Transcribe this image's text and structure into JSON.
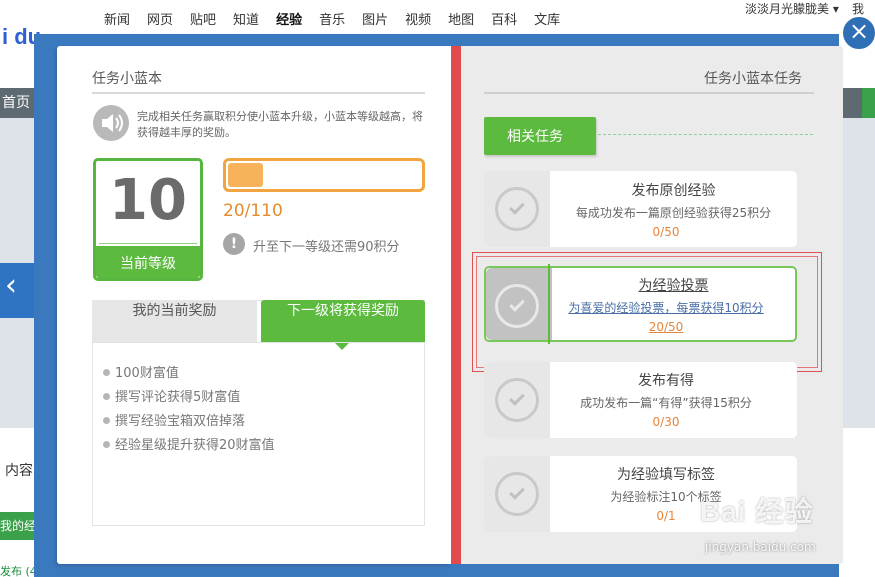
{
  "background": {
    "nav_links": [
      "新闻",
      "网页",
      "贴吧",
      "知道",
      "经验",
      "音乐",
      "图片",
      "视频",
      "地图",
      "百科",
      "文库"
    ],
    "nav_active": "经验",
    "logo_text": "i du",
    "username": "淡淡月光朦胧美 ▾",
    "username_more": "我的",
    "home_tab": "首页",
    "content_label": "内容",
    "green_bar_text": "我的经",
    "bottom_text": "发布 (4"
  },
  "dialog": {
    "close_symbol": "×",
    "left_page": {
      "title": "任务小蓝本",
      "description": "完成相关任务赢取积分使小蓝本升级，小蓝本等级越高，将获得越丰厚的奖励。",
      "level_number": "10",
      "level_label": "当前等级",
      "progress_text": "20/110",
      "progress_fraction": 0.18,
      "info_symbol": "!",
      "next_level_text": "升至下一等级还需90积分",
      "tabs": {
        "current": "我的当前奖励",
        "next": "下一级将获得奖励"
      },
      "rewards": [
        "100财富值",
        "撰写评论获得5财富值",
        "撰写经验宝箱双倍掉落",
        "经验星级提升获得20财富值"
      ]
    },
    "right_page": {
      "title": "任务小蓝本任务",
      "related_label": "相关任务",
      "tasks": [
        {
          "title": "发布原创经验",
          "desc": "每成功发布一篇原创经验获得25积分",
          "progress": "0/50"
        },
        {
          "title": "为经验投票",
          "desc": "为喜爱的经验投票，每票获得10积分",
          "progress": "20/50"
        },
        {
          "title": "发布有得",
          "desc": "成功发布一篇“有得”获得15积分",
          "progress": "0/30"
        },
        {
          "title": "为经验填写标签",
          "desc": "为经验标注10个标签",
          "progress": "0/1"
        }
      ]
    }
  },
  "watermark": {
    "brand": "Bai 经验",
    "url": "jingyan.baidu.com"
  },
  "colors": {
    "accent_green": "#5cba3f",
    "accent_blue": "#3b79bf",
    "accent_orange": "#f0a541",
    "highlight_red": "#e05050"
  }
}
